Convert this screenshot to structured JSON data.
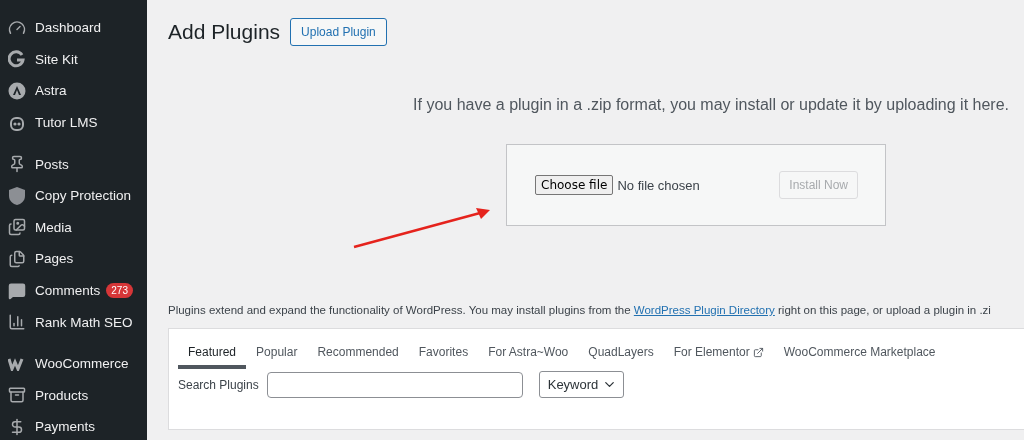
{
  "sidebar": {
    "groups": [
      [
        {
          "label": "Dashboard"
        },
        {
          "label": "Site Kit"
        },
        {
          "label": "Astra"
        },
        {
          "label": "Tutor LMS"
        }
      ],
      [
        {
          "label": "Posts"
        },
        {
          "label": "Copy Protection"
        },
        {
          "label": "Media"
        },
        {
          "label": "Pages"
        },
        {
          "label": "Comments",
          "badge": "273"
        },
        {
          "label": "Rank Math SEO"
        }
      ],
      [
        {
          "label": "WooCommerce"
        },
        {
          "label": "Products"
        },
        {
          "label": "Payments"
        }
      ]
    ]
  },
  "header": {
    "title": "Add Plugins",
    "button": "Upload Plugin"
  },
  "upload": {
    "intro": "If you have a plugin in a .zip format, you may install or update it by uploading it here.",
    "choose": "Choose file",
    "file_status": "No file chosen",
    "install": "Install Now",
    "install_disabled": true
  },
  "description": {
    "before": "Plugins extend and expand the functionality of WordPress. You may install plugins from the ",
    "link": "WordPress Plugin Directory",
    "after": " right on this page, or upload a plugin in .zi"
  },
  "tabs": [
    {
      "label": "Featured",
      "selected": true
    },
    {
      "label": "Popular",
      "selected": false
    },
    {
      "label": "Recommended",
      "selected": false
    },
    {
      "label": "Favorites",
      "selected": false
    },
    {
      "label": "For Astra~Woo",
      "selected": false
    },
    {
      "label": "QuadLayers",
      "selected": false
    },
    {
      "label": "For Elementor",
      "selected": false,
      "external": true
    },
    {
      "label": "WooCommerce Marketplace",
      "selected": false
    }
  ],
  "search": {
    "label": "Search Plugins",
    "type": "Keyword"
  }
}
